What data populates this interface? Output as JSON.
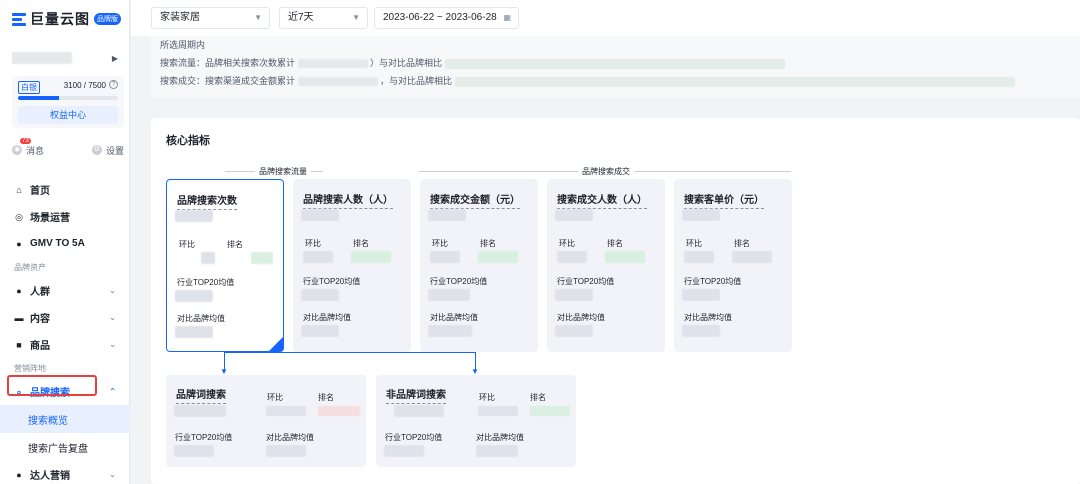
{
  "brand": {
    "name": "巨量云图",
    "badge": "品牌版"
  },
  "quota": {
    "label": "白银",
    "value": "3100 / 7500",
    "help_icon": "question-icon",
    "progress": 0.41,
    "benefit_button": "权益中心"
  },
  "sidebar_actions": {
    "message": "消息",
    "message_badge": "73",
    "settings": "设置"
  },
  "nav": {
    "home": "首页",
    "scene": "场景运营",
    "gmv": "GMV TO 5A",
    "group_brand_assets": "品牌资产",
    "crowd": "人群",
    "content": "内容",
    "goods": "商品",
    "group_marketing": "营销阵地",
    "brand_search": "品牌搜索",
    "search_overview": "搜索概览",
    "search_ad_review": "搜索广告复盘",
    "talent": "达人营销"
  },
  "filters": {
    "industry": "家装家居",
    "period": "近7天",
    "date_range": "2023-06-22 ~ 2023-06-28"
  },
  "summary": {
    "line1": "所选周期内",
    "line2_prefix": "搜索流量：品牌相关搜索次数累计",
    "line2_suffix": "）与对比品牌相比",
    "line3_prefix": "搜索成交：搜索渠道成交金额累计",
    "line3_suffix": "，与对比品牌相比"
  },
  "core": {
    "title": "核心指标",
    "group_traffic": "品牌搜索流量",
    "group_deal": "品牌搜索成交",
    "labels": {
      "mom": "环比",
      "rank": "排名",
      "top20": "行业TOP20均值",
      "compare": "对比品牌均值"
    },
    "cards": [
      {
        "title": "品牌搜索次数"
      },
      {
        "title": "品牌搜索人数（人）"
      },
      {
        "title": "搜索成交金额（元）"
      },
      {
        "title": "搜索成交人数（人）"
      },
      {
        "title": "搜索客单价（元）"
      }
    ],
    "sub_cards": [
      {
        "title": "品牌词搜索"
      },
      {
        "title": "非品牌词搜索"
      }
    ]
  },
  "colors": {
    "accent": "#1664ff",
    "highlight": "#e34040"
  }
}
